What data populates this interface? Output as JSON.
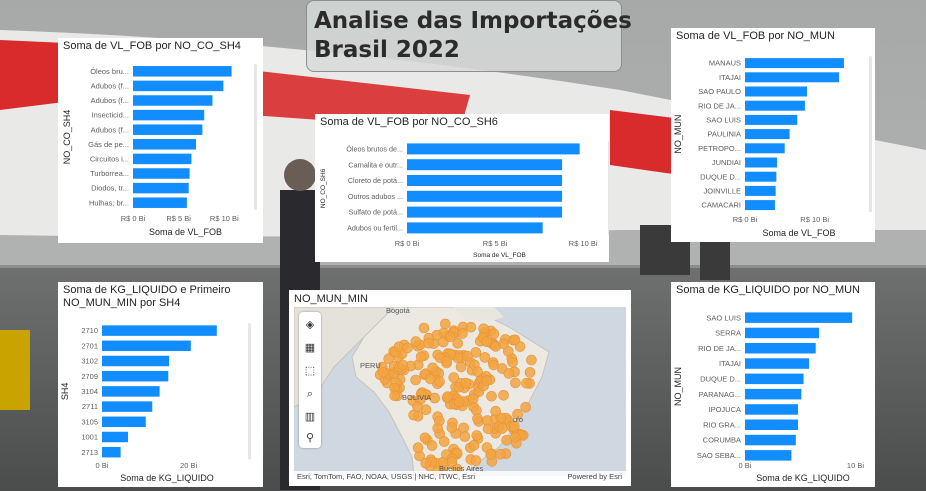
{
  "page": {
    "title_line1": "Analise das Importações",
    "title_line2": "Brasil 2022"
  },
  "colors": {
    "bar": "#118DFF",
    "text": "#605E5C",
    "marker": "#F2A541"
  },
  "charts": {
    "sh4_vlfob": {
      "title": "Soma de VL_FOB por NO_CO_SH4",
      "xlabel": "Soma de VL_FOB",
      "ylabel": "NO_CO_SH4",
      "ticks": [
        "R$ 0 Bi",
        "R$ 5 Bi",
        "R$ 10 Bi"
      ]
    },
    "sh6_vlfob": {
      "title": "Soma de VL_FOB por NO_CO_SH6",
      "xlabel": "Soma de VL_FOB",
      "ylabel": "NO_CO_SH6",
      "ticks": [
        "R$ 0 Bi",
        "R$ 5 Bi",
        "R$ 10 Bi"
      ]
    },
    "mun_vlfob": {
      "title": "Soma de VL_FOB por NO_MUN",
      "xlabel": "Soma de VL_FOB",
      "ylabel": "NO_MUN",
      "ticks": [
        "R$ 0 Bi",
        "R$ 10 Bi"
      ]
    },
    "sh4_kg": {
      "title_line1": "Soma de KG_LIQUIDO e Primeiro",
      "title_line2": "NO_MUN_MIN por SH4",
      "xlabel": "Soma de KG_LIQUIDO",
      "ylabel": "SH4",
      "ticks": [
        "0 Bi",
        "20 Bi"
      ]
    },
    "mun_kg": {
      "title": "Soma de KG_LIQUIDO por NO_MUN",
      "xlabel": "Soma de KG_LIQUIDO",
      "ylabel": "NO_MUN",
      "ticks": [
        "0 Bi",
        "10 Bi"
      ]
    }
  },
  "map": {
    "title": "NO_MUN_MIN",
    "attribution": "Esri, TomTom, FAO, NOAA, USGS | NHC, ITWC, Esri",
    "powered": "Powered by Esri",
    "places": [
      "Bogotá",
      "PERU",
      "BOLIVIA",
      "Buenos Aires",
      "ulo"
    ],
    "tools": [
      "layers-icon",
      "table-icon",
      "select-icon",
      "search-icon",
      "chart-icon",
      "locate-icon"
    ]
  },
  "chart_data": [
    {
      "type": "bar",
      "orientation": "horizontal",
      "title": "Soma de VL_FOB por NO_CO_SH4",
      "xlabel": "Soma de VL_FOB",
      "ylabel": "NO_CO_SH4",
      "categories": [
        "Óleos bru...",
        "Adubos (f...",
        "Adubos (f...",
        "Insecticid...",
        "Adubos (f...",
        "Gás de pe...",
        "Circuitos i...",
        "Turborrea...",
        "Diodos, tr...",
        "Hulhas; br..."
      ],
      "values": [
        10.8,
        9.9,
        8.7,
        7.8,
        7.6,
        6.9,
        6.4,
        6.2,
        6.1,
        5.9
      ],
      "unit": "R$ Bi",
      "xlim": [
        0,
        11.5
      ]
    },
    {
      "type": "bar",
      "orientation": "horizontal",
      "title": "Soma de VL_FOB por NO_CO_SH6",
      "xlabel": "Soma de VL_FOB",
      "ylabel": "NO_CO_SH6",
      "categories": [
        "Óleos brutos de...",
        "Carnalita e outr...",
        "Cloreto de potá...",
        "Outros adubos ...",
        "Sulfato de potá...",
        "Adubos ou fertil..."
      ],
      "values": [
        9.8,
        8.8,
        8.8,
        8.8,
        8.8,
        7.7
      ],
      "unit": "R$ Bi",
      "xlim": [
        0,
        10.5
      ]
    },
    {
      "type": "bar",
      "orientation": "horizontal",
      "title": "Soma de VL_FOB por NO_MUN",
      "xlabel": "Soma de VL_FOB",
      "ylabel": "NO_MUN",
      "categories": [
        "MANAUS",
        "ITAJAI",
        "SAO PAULO",
        "RIO DE JA...",
        "SAO LUIS",
        "PAULINIA",
        "PETROPO...",
        "JUNDIAI",
        "DUQUE D...",
        "JOINVILLE",
        "CAMACARI"
      ],
      "values": [
        14.2,
        13.5,
        8.9,
        8.6,
        7.5,
        6.4,
        5.7,
        4.6,
        4.5,
        4.4,
        4.3
      ],
      "unit": "R$ Bi",
      "xlim": [
        0,
        15.5
      ]
    },
    {
      "type": "bar",
      "orientation": "horizontal",
      "title": "Soma de KG_LIQUIDO e Primeiro NO_MUN_MIN por SH4",
      "xlabel": "Soma de KG_LIQUIDO",
      "ylabel": "SH4",
      "categories": [
        "2710",
        "2701",
        "3102",
        "2709",
        "3104",
        "2711",
        "3105",
        "1001",
        "2713"
      ],
      "values": [
        26.5,
        20.5,
        15.5,
        15.3,
        13.3,
        11.6,
        10.1,
        6.0,
        4.3
      ],
      "unit": "Bi",
      "xlim": [
        0,
        30
      ]
    },
    {
      "type": "bar",
      "orientation": "horizontal",
      "title": "Soma de KG_LIQUIDO por NO_MUN",
      "xlabel": "Soma de KG_LIQUIDO",
      "ylabel": "NO_MUN",
      "categories": [
        "SAO LUIS",
        "SERRA",
        "RIO DE JA...",
        "ITAJAI",
        "DUQUE D...",
        "PARANAG...",
        "IPOJUCA",
        "RIO GRA...",
        "CORUMBA",
        "SAO SEBA..."
      ],
      "values": [
        9.7,
        6.7,
        6.4,
        5.8,
        5.3,
        5.1,
        4.8,
        4.8,
        4.6,
        4.2
      ],
      "unit": "Bi",
      "xlim": [
        0,
        10.5
      ]
    }
  ]
}
